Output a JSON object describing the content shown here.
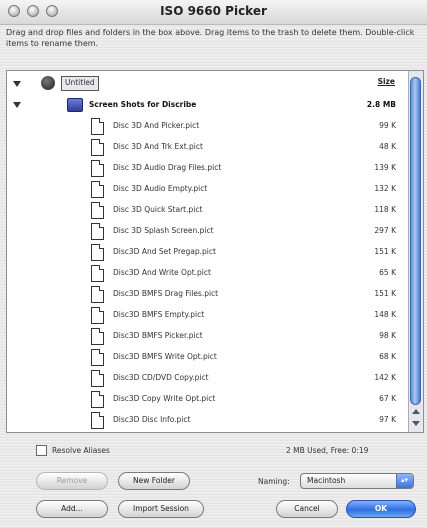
{
  "window": {
    "title": "ISO 9660 Picker",
    "instructions": "Drag and drop files and folders in the box above. Drag items to the trash to delete them. Double-click items to rename them."
  },
  "list": {
    "size_header": "Size",
    "root_label": "Untitled",
    "folder": {
      "name": "Screen Shots for Discribe",
      "size": "2.8 MB"
    },
    "files": [
      {
        "name": "Disc 3D And Picker.pict",
        "size": "99 K"
      },
      {
        "name": "Disc 3D And Trk Ext.pict",
        "size": "48 K"
      },
      {
        "name": "Disc 3D Audio Drag Files.pict",
        "size": "139 K"
      },
      {
        "name": "Disc 3D Audio Empty.pict",
        "size": "132 K"
      },
      {
        "name": "Disc 3D Quick Start.pict",
        "size": "118 K"
      },
      {
        "name": "Disc 3D Splash Screen.pict",
        "size": "297 K"
      },
      {
        "name": "Disc3D And Set Pregap.pict",
        "size": "151 K"
      },
      {
        "name": "Disc3D And Write Opt.pict",
        "size": "65 K"
      },
      {
        "name": "Disc3D BMFS Drag Files.pict",
        "size": "151 K"
      },
      {
        "name": "Disc3D BMFS Empty.pict",
        "size": "148 K"
      },
      {
        "name": "Disc3D BMFS Picker.pict",
        "size": "98 K"
      },
      {
        "name": "Disc3D BMFS Write Opt.pict",
        "size": "68 K"
      },
      {
        "name": "Disc3D CD/DVD Copy.pict",
        "size": "142 K"
      },
      {
        "name": "Disc3D Copy Write Opt.pict",
        "size": "67 K"
      },
      {
        "name": "Disc3D Disc Info.pict",
        "size": "97 K"
      }
    ]
  },
  "footer": {
    "resolve_aliases_label": "Resolve Aliases",
    "status": "2 MB Used, Free: 0:19",
    "naming_label": "Naming:",
    "naming_value": "Macintosh"
  },
  "buttons": {
    "remove": "Remove",
    "new_folder": "New Folder",
    "add": "Add...",
    "import_session": "Import Session",
    "cancel": "Cancel",
    "ok": "OK"
  }
}
